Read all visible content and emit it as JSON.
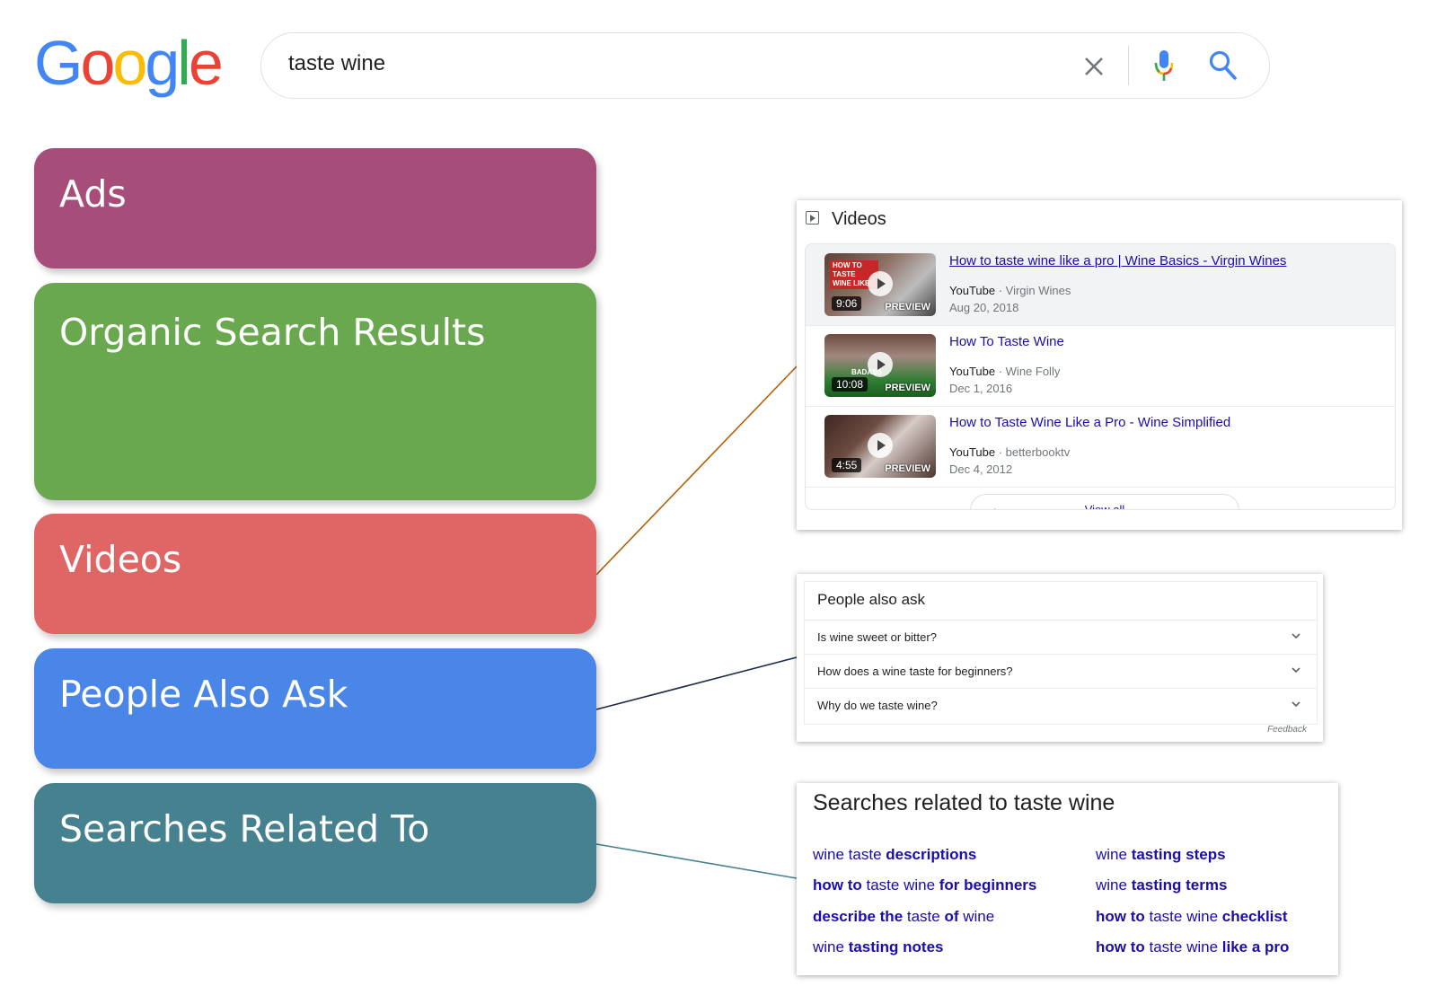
{
  "logo": {
    "letters": [
      "G",
      "o",
      "o",
      "g",
      "l",
      "e"
    ],
    "colors": [
      "#4285f4",
      "#ea4335",
      "#fbbc05",
      "#4285f4",
      "#34a853",
      "#ea4335"
    ]
  },
  "search": {
    "query": "taste wine",
    "icons": [
      "clear-icon",
      "mic-icon",
      "search-icon"
    ]
  },
  "categories": {
    "ads": "Ads",
    "organic": "Organic Search Results",
    "videos": "Videos",
    "people_also_ask": "People Also Ask",
    "related": "Searches Related To"
  },
  "colors": {
    "ads": "#a64d79",
    "organic": "#6aa84f",
    "videos": "#e06666",
    "people_also_ask": "#4a86e8",
    "related": "#45818e",
    "line_videos": "#b45f06",
    "line_paa": "#1c2a4a",
    "line_related": "#45818e",
    "link": "#1a0dab"
  },
  "videos_panel": {
    "heading": "Videos",
    "items": [
      {
        "title": "How to taste wine like a pro | Wine Basics - Virgin Wines",
        "platform": "YouTube",
        "channel": "Virgin Wines",
        "date": "Aug 20, 2018",
        "duration": "9:06",
        "preview": "PREVIEW",
        "thumb_text": "HOW TO TASTE WINE LIKE"
      },
      {
        "title": "How To Taste Wine",
        "platform": "YouTube",
        "channel": "Wine Folly",
        "date": "Dec 1, 2016",
        "duration": "10:08",
        "preview": "PREVIEW",
        "thumb_text": "BADASS"
      },
      {
        "title": "How to Taste Wine Like a Pro - Wine Simplified",
        "platform": "YouTube",
        "channel": "betterbooktv",
        "date": "Dec 4, 2012",
        "duration": "4:55",
        "preview": "PREVIEW",
        "thumb_text": ""
      }
    ],
    "view_all": "View all",
    "separator": " · "
  },
  "people_also_ask": {
    "heading": "People also ask",
    "questions": [
      "Is wine sweet or bitter?",
      "How does a wine taste for beginners?",
      "Why do we taste wine?"
    ],
    "feedback": "Feedback"
  },
  "related_searches": {
    "heading": "Searches related to taste wine",
    "left": [
      [
        {
          "t": "wine taste ",
          "b": false
        },
        {
          "t": "descriptions",
          "b": true
        }
      ],
      [
        {
          "t": "how to ",
          "b": true
        },
        {
          "t": "taste wine ",
          "b": false
        },
        {
          "t": "for beginners",
          "b": true
        }
      ],
      [
        {
          "t": "describe the ",
          "b": true
        },
        {
          "t": "taste ",
          "b": false
        },
        {
          "t": "of ",
          "b": true
        },
        {
          "t": "wine",
          "b": false
        }
      ],
      [
        {
          "t": "wine ",
          "b": false
        },
        {
          "t": "tasting notes",
          "b": true
        }
      ]
    ],
    "right": [
      [
        {
          "t": "wine ",
          "b": false
        },
        {
          "t": "tasting steps",
          "b": true
        }
      ],
      [
        {
          "t": "wine ",
          "b": false
        },
        {
          "t": "tasting terms",
          "b": true
        }
      ],
      [
        {
          "t": "how to ",
          "b": true
        },
        {
          "t": "taste wine ",
          "b": false
        },
        {
          "t": "checklist",
          "b": true
        }
      ],
      [
        {
          "t": "how to ",
          "b": true
        },
        {
          "t": "taste wine ",
          "b": false
        },
        {
          "t": "like a pro",
          "b": true
        }
      ]
    ]
  }
}
